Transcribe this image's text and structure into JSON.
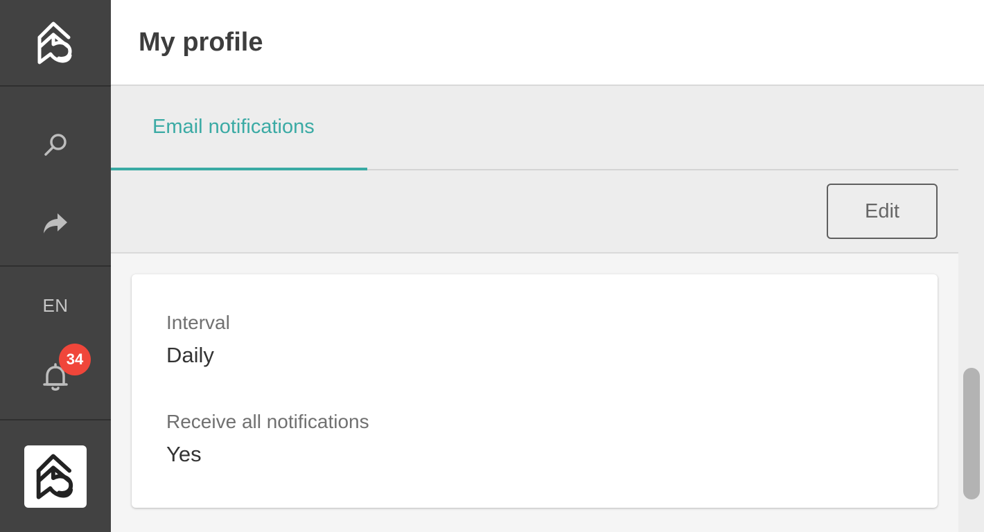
{
  "sidebar": {
    "logo_icon": "brand-logo-icon",
    "search_icon": "search-icon",
    "share_icon": "share-arrow-icon",
    "language": "EN",
    "notifications_icon": "bell-icon",
    "notifications_count": "34",
    "avatar_icon": "brand-logo-icon"
  },
  "header": {
    "title": "My profile"
  },
  "tabs": [
    {
      "label": "Email notifications",
      "active": true
    }
  ],
  "toolbar": {
    "edit_label": "Edit"
  },
  "card": {
    "fields": [
      {
        "label": "Interval",
        "value": "Daily"
      },
      {
        "label": "Receive all notifications",
        "value": "Yes"
      }
    ]
  },
  "colors": {
    "accent": "#3aaaa4",
    "sidebar_bg": "#424242",
    "badge": "#f0463a"
  }
}
